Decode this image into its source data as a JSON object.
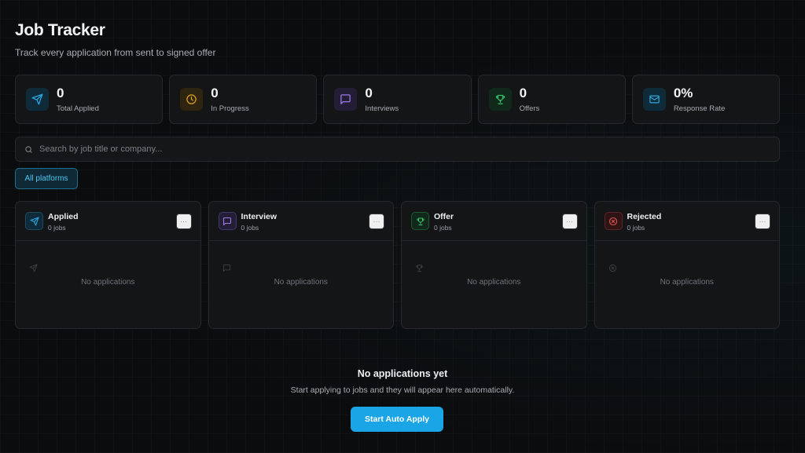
{
  "header": {
    "title": "Job Tracker",
    "subtitle": "Track every application from sent to signed offer"
  },
  "stats": [
    {
      "value": "0",
      "label": "Total Applied",
      "icon": "send-icon",
      "color": "#2aa7e0"
    },
    {
      "value": "0",
      "label": "In Progress",
      "icon": "clock-icon",
      "color": "#e0a21f"
    },
    {
      "value": "0",
      "label": "Interviews",
      "icon": "message-icon",
      "color": "#9b7be3"
    },
    {
      "value": "0",
      "label": "Offers",
      "icon": "trophy-icon",
      "color": "#35c06a"
    },
    {
      "value": "0%",
      "label": "Response Rate",
      "icon": "mail-icon",
      "color": "#2aa7e0"
    }
  ],
  "search": {
    "placeholder": "Search by job title or company..."
  },
  "filter": {
    "label": "All platforms"
  },
  "columns": [
    {
      "title": "Applied",
      "count": "0 jobs",
      "empty": "No applications",
      "menu": "···",
      "icon": "send-icon",
      "color": "#2aa7e0"
    },
    {
      "title": "Interview",
      "count": "0 jobs",
      "empty": "No applications",
      "menu": "···",
      "icon": "message-icon",
      "color": "#9b7be3"
    },
    {
      "title": "Offer",
      "count": "0 jobs",
      "empty": "No applications",
      "menu": "···",
      "icon": "trophy-icon",
      "color": "#35c06a"
    },
    {
      "title": "Rejected",
      "count": "0 jobs",
      "empty": "No applications",
      "menu": "···",
      "icon": "x-circle-icon",
      "color": "#e25151"
    }
  ],
  "empty_state": {
    "title": "No applications yet",
    "description": "Start applying to jobs and they will appear here automatically.",
    "button": "Start Auto Apply"
  }
}
